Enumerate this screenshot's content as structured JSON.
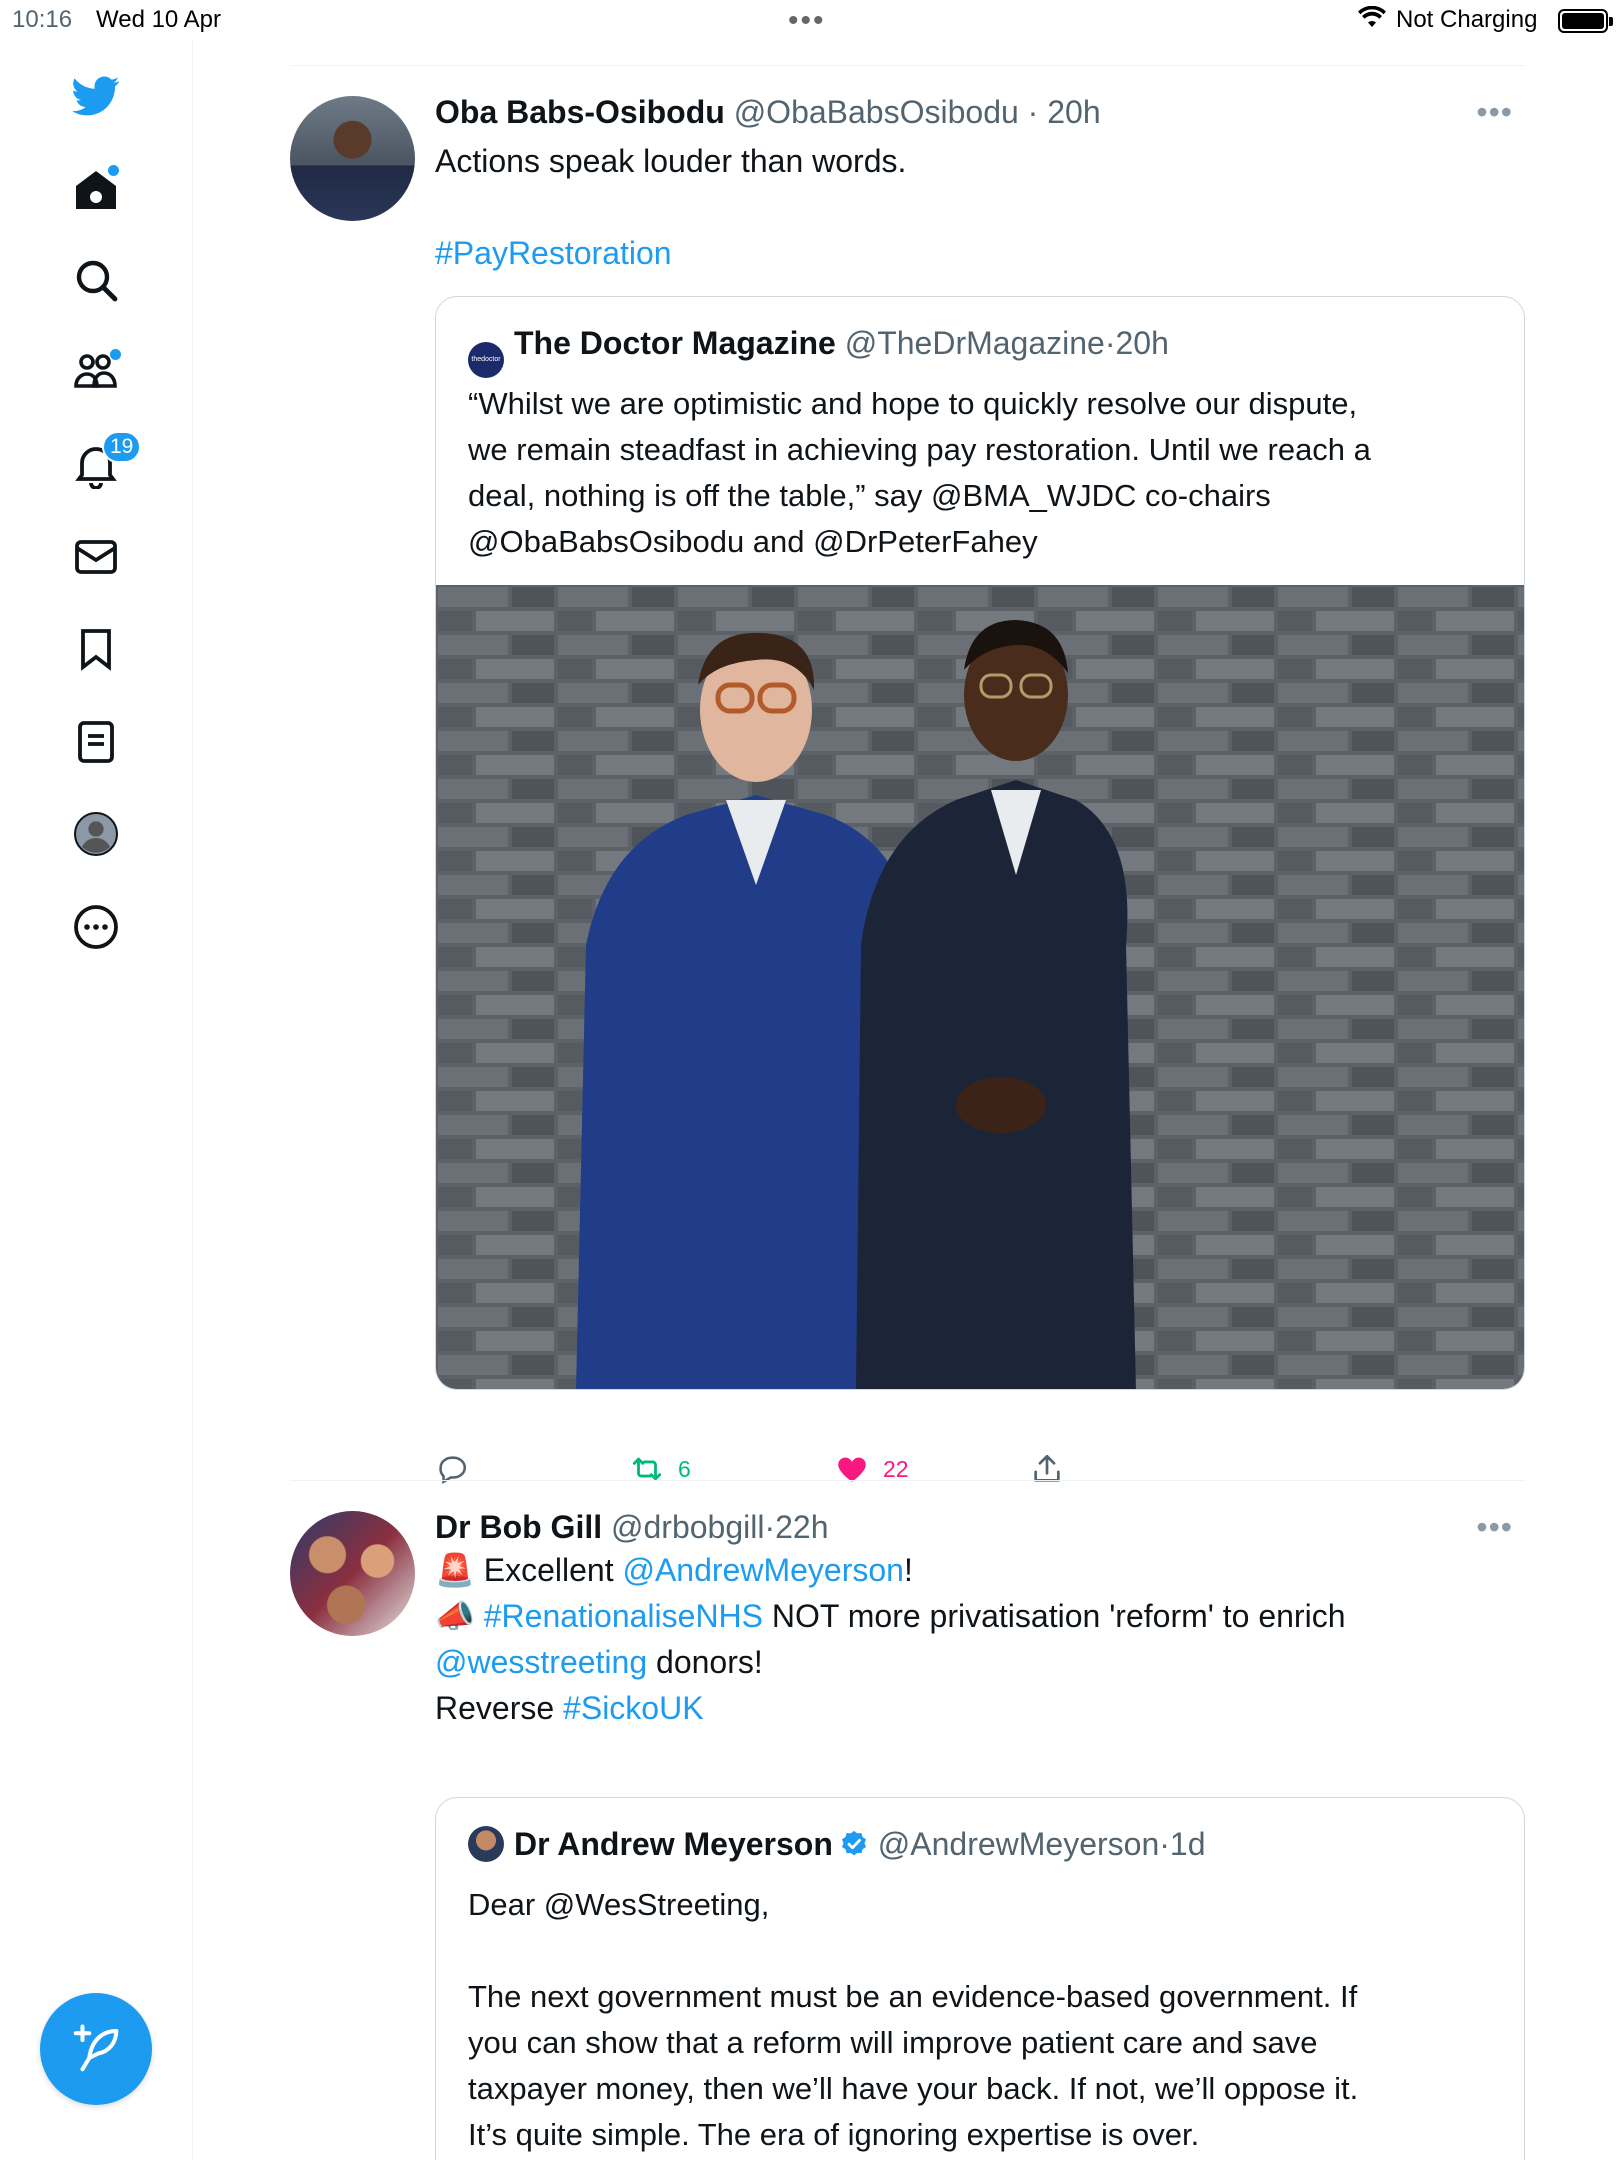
{
  "status_bar": {
    "time": "10:16",
    "date": "Wed 10 Apr",
    "charging": "Not Charging",
    "battery_level": 1.0
  },
  "sidebar": {
    "items": [
      {
        "name": "twitter-logo-icon"
      },
      {
        "name": "home-icon",
        "dot": true
      },
      {
        "name": "search-icon"
      },
      {
        "name": "communities-icon",
        "dot": true
      },
      {
        "name": "notifications-icon",
        "badge": "19"
      },
      {
        "name": "messages-icon"
      },
      {
        "name": "bookmarks-icon"
      },
      {
        "name": "lists-icon"
      },
      {
        "name": "profile-icon"
      },
      {
        "name": "more-icon"
      }
    ],
    "accent_color": "#1d9bf0"
  },
  "tweets": [
    {
      "name": "Oba Babs-Osibodu",
      "handle": "@ObaBabsOsibodu",
      "sep": "·",
      "time": "20h",
      "text_line1": "Actions speak louder than words.",
      "hashtag": "#PayRestoration",
      "quote": {
        "name": "The Doctor Magazine",
        "handle": "@TheDrMagazine",
        "sep": "·",
        "time": "20h",
        "avatar_text": "thedoctor",
        "lines": [
          "“Whilst we are optimistic and hope to quickly resolve our dispute,",
          "we remain steadfast in achieving pay restoration. Until we reach a",
          "deal, nothing is off the table,” say @BMA_WJDC co-chairs",
          "@ObaBabsOsibodu and @DrPeterFahey"
        ]
      },
      "actions": {
        "replies": "",
        "retweets": "6",
        "likes": "22"
      }
    },
    {
      "name": "Dr Bob Gill",
      "handle": "@drbobgill",
      "sep": "·",
      "time": "22h",
      "line1_pre": "Excellent ",
      "line1_link": "@AndrewMeyerson",
      "line1_post": "!",
      "line2_link": "#RenationaliseNHS",
      "line2_post": " NOT more privatisation 'reform' to enrich",
      "line3_link": "@wesstreeting",
      "line3_post": " donors!",
      "line4_pre": "Reverse ",
      "line4_link": "#SickoUK",
      "quote": {
        "name": "Dr Andrew Meyerson",
        "handle": "@AndrewMeyerson",
        "sep": "·",
        "time": "1d",
        "greeting": "Dear @WesStreeting,",
        "lines": [
          "The next government must be an evidence-based government. If",
          "you can show that a reform will improve patient care and save",
          "taxpayer money, then we’ll have your back. If not, we’ll oppose it.",
          "It’s quite simple. The era of ignoring expertise is over."
        ]
      }
    }
  ]
}
